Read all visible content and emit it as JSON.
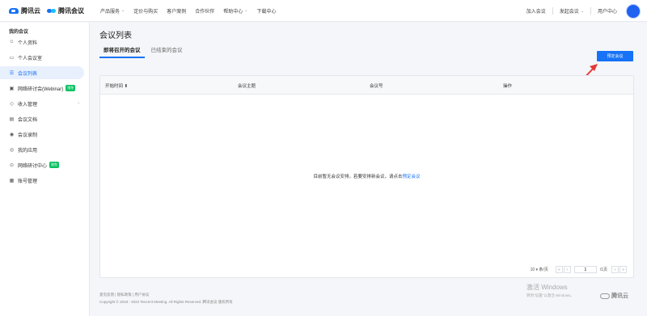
{
  "header": {
    "brand_cloud": "腾讯云",
    "brand_meeting": "腾讯会议",
    "nav": [
      {
        "label": "产品服务",
        "has_caret": true
      },
      {
        "label": "定价与购买",
        "has_caret": false
      },
      {
        "label": "客户案例",
        "has_caret": false
      },
      {
        "label": "合作伙伴",
        "has_caret": false
      },
      {
        "label": "帮助中心",
        "has_caret": true
      },
      {
        "label": "下载中心",
        "has_caret": false
      }
    ],
    "join_label": "加入会议",
    "host_label": "发起会议",
    "user_center_label": "用户中心",
    "caret": "⌄"
  },
  "sidebar": {
    "title": "我的会议",
    "items": [
      {
        "label": "个人资料",
        "icon": "user-icon",
        "glyph": "☺"
      },
      {
        "label": "个人会议室",
        "icon": "meeting-room-icon",
        "glyph": "▭"
      },
      {
        "label": "会议列表",
        "icon": "list-icon",
        "glyph": "☰",
        "active": true
      },
      {
        "label": "网络研讨会(Webinar)",
        "icon": "webinar-icon",
        "glyph": "▣",
        "badge": "限免"
      },
      {
        "label": "收入管理",
        "icon": "income-icon",
        "glyph": "◇",
        "has_caret": true
      },
      {
        "label": "会议文档",
        "icon": "document-icon",
        "glyph": "▤"
      },
      {
        "label": "会议录制",
        "icon": "record-icon",
        "glyph": "◉"
      },
      {
        "label": "我的应用",
        "icon": "apps-icon",
        "glyph": "◎"
      },
      {
        "label": "网络研讨中心",
        "icon": "webinar-center-icon",
        "glyph": "⊙",
        "badge": "限免"
      },
      {
        "label": "账号管理",
        "icon": "account-icon",
        "glyph": "▦"
      }
    ],
    "caret": "›"
  },
  "main": {
    "title": "会议列表",
    "tabs": [
      {
        "label": "即将召开的会议",
        "active": true
      },
      {
        "label": "已结束的会议",
        "active": false
      }
    ],
    "book_button": "预定会议",
    "table": {
      "columns": [
        "开始时间 ⬆",
        "会议主题",
        "会议号",
        "操作"
      ],
      "empty_text": "目前暂无会议安排，若要安排新会议，请点击",
      "empty_link": "预定会议"
    },
    "pagination": {
      "page_size": "10 ▾ 条/页",
      "first": "«",
      "prev": "‹",
      "current_page": "1",
      "total": "/1页",
      "next": "›",
      "last": "»"
    }
  },
  "footer": {
    "links": "意见反馈 | 隐私政策 | 用户协议",
    "copyright": "Copyright © 2018 - 2022 Tencent Meeting. All Rights Reserved. 腾讯会议 版权所有"
  },
  "watermark": {
    "title": "激活 Windows",
    "subtitle": "转到\"设置\"以激活 Windows。",
    "logo_text": "腾讯云"
  },
  "colors": {
    "accent": "#1772f6",
    "badge": "#07c160",
    "arrow": "#e53935"
  }
}
